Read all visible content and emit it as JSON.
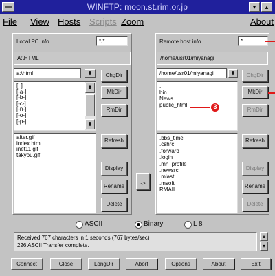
{
  "window": {
    "title": "WINFTP: moon.st.rim.or.jp",
    "controls": [
      "▾",
      "▴"
    ]
  },
  "menu": [
    {
      "label": "File",
      "enabled": true
    },
    {
      "label": "View",
      "enabled": true
    },
    {
      "label": "Hosts",
      "enabled": true
    },
    {
      "label": "Scripts",
      "enabled": false
    },
    {
      "label": "Zoom",
      "enabled": true
    },
    {
      "label": "About",
      "enabled": true
    }
  ],
  "local": {
    "info_label": "Local PC info",
    "filter": "*.*",
    "path": "A:\\HTML",
    "drive": "a:\\html",
    "dirs": [
      "[..]",
      "[-a-]",
      "[-b-]",
      "[-c-]",
      "[-n-]",
      "[-o-]",
      "[-p-]"
    ],
    "files": [
      "after.gif",
      "index.htm",
      "inet11.gif",
      "takyou.gif"
    ],
    "buttons": {
      "chgdir": "ChgDir",
      "mkdir": "MkDir",
      "rmdir": "RmDir",
      "refresh": "Refresh",
      "display": "Display",
      "rename": "Rename",
      "delete": "Delete"
    }
  },
  "remote": {
    "info_label": "Remote host info",
    "filter": "*",
    "path": "/home/usr01/miyanagi",
    "dir": "/home/usr01/miyanagi",
    "dirs": [
      "..",
      "bin",
      "News",
      "public_html"
    ],
    "files": [
      ".bbs_time",
      ".cshrc",
      ".forward",
      ".login",
      ".mh_profile",
      ".newsrc",
      ".mlast",
      ".msoft",
      "RMAIL"
    ],
    "buttons": {
      "chgdir": "ChgDir",
      "mkdir": "MkDir",
      "rmdir": "RmDir",
      "refresh": "Refresh",
      "display": "Display",
      "rename": "Rename",
      "delete": "Delete"
    }
  },
  "transfer": {
    "left_arrow": "<-",
    "right_arrow": "->"
  },
  "mode": {
    "options": [
      "ASCII",
      "Binary",
      "L 8"
    ],
    "selected": "Binary"
  },
  "status": [
    "Received 767 characters in 1 seconds (767 bytes/sec)",
    "226 ASCII Transfer complete."
  ],
  "bottom_buttons": [
    "Connect",
    "Close",
    "LongDir",
    "Abort",
    "Options",
    "About",
    "Exit"
  ],
  "callout": {
    "number": "3",
    "color": "#e01818"
  }
}
